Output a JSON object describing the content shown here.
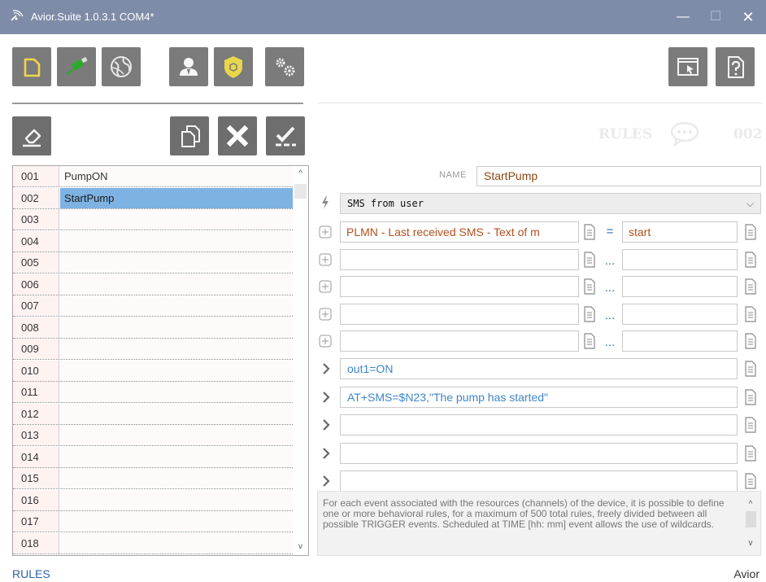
{
  "window": {
    "title": "Avior.Suite 1.0.3.1  COM4*",
    "minimize_glyph": "—",
    "maximize_glyph": "☐",
    "close_glyph": "✕"
  },
  "toolbar": {
    "buttons": [
      "new-file-icon",
      "usb-connect-icon",
      "network-globe-icon",
      "user-icon",
      "security-shield-icon",
      "settings-gears-icon",
      "window-cursor-icon",
      "help-document-icon"
    ]
  },
  "list_toolbar": {
    "buttons": [
      "eraser-icon",
      "copy-icon",
      "delete-x-icon",
      "confirm-check-icon"
    ]
  },
  "rules_header": {
    "title": "RULES",
    "number": "002"
  },
  "rules": [
    {
      "num": "001",
      "name": "PumpON"
    },
    {
      "num": "002",
      "name": "StartPump",
      "selected": true
    },
    {
      "num": "003",
      "name": ""
    },
    {
      "num": "004",
      "name": ""
    },
    {
      "num": "005",
      "name": ""
    },
    {
      "num": "006",
      "name": ""
    },
    {
      "num": "007",
      "name": ""
    },
    {
      "num": "008",
      "name": ""
    },
    {
      "num": "009",
      "name": ""
    },
    {
      "num": "010",
      "name": ""
    },
    {
      "num": "011",
      "name": ""
    },
    {
      "num": "012",
      "name": ""
    },
    {
      "num": "013",
      "name": ""
    },
    {
      "num": "014",
      "name": ""
    },
    {
      "num": "015",
      "name": ""
    },
    {
      "num": "016",
      "name": ""
    },
    {
      "num": "017",
      "name": ""
    },
    {
      "num": "018",
      "name": ""
    }
  ],
  "editor": {
    "name_label": "NAME",
    "name_value": "StartPump",
    "trigger": "SMS from user",
    "conditions": [
      {
        "left": "PLMN - Last received SMS - Text of m",
        "op": "=",
        "right": "start"
      },
      {
        "left": "",
        "op": "...",
        "right": ""
      },
      {
        "left": "",
        "op": "...",
        "right": ""
      },
      {
        "left": "",
        "op": "...",
        "right": ""
      },
      {
        "left": "",
        "op": "...",
        "right": ""
      }
    ],
    "actions": [
      "out1=ON",
      "AT+SMS=$N23,\"The pump has started\"",
      "",
      "",
      ""
    ],
    "info": "For each event associated with the resources (channels) of the device, it is possible to define one or more behavioral rules, for a maximum of 500 total rules, freely divided between all possible TRIGGER events. Scheduled at TIME [hh: mm] event allows the use of wildcards."
  },
  "footer": {
    "left": "RULES",
    "right": "Avior"
  },
  "colors": {
    "titlebar": "#7f8ca7",
    "toolbar_button": "#7b7b7b",
    "selected_row": "#7db2e3",
    "usb_green": "#2fa82f",
    "shield_yellow": "#e8d64a",
    "file_yellow": "#f2d548"
  }
}
